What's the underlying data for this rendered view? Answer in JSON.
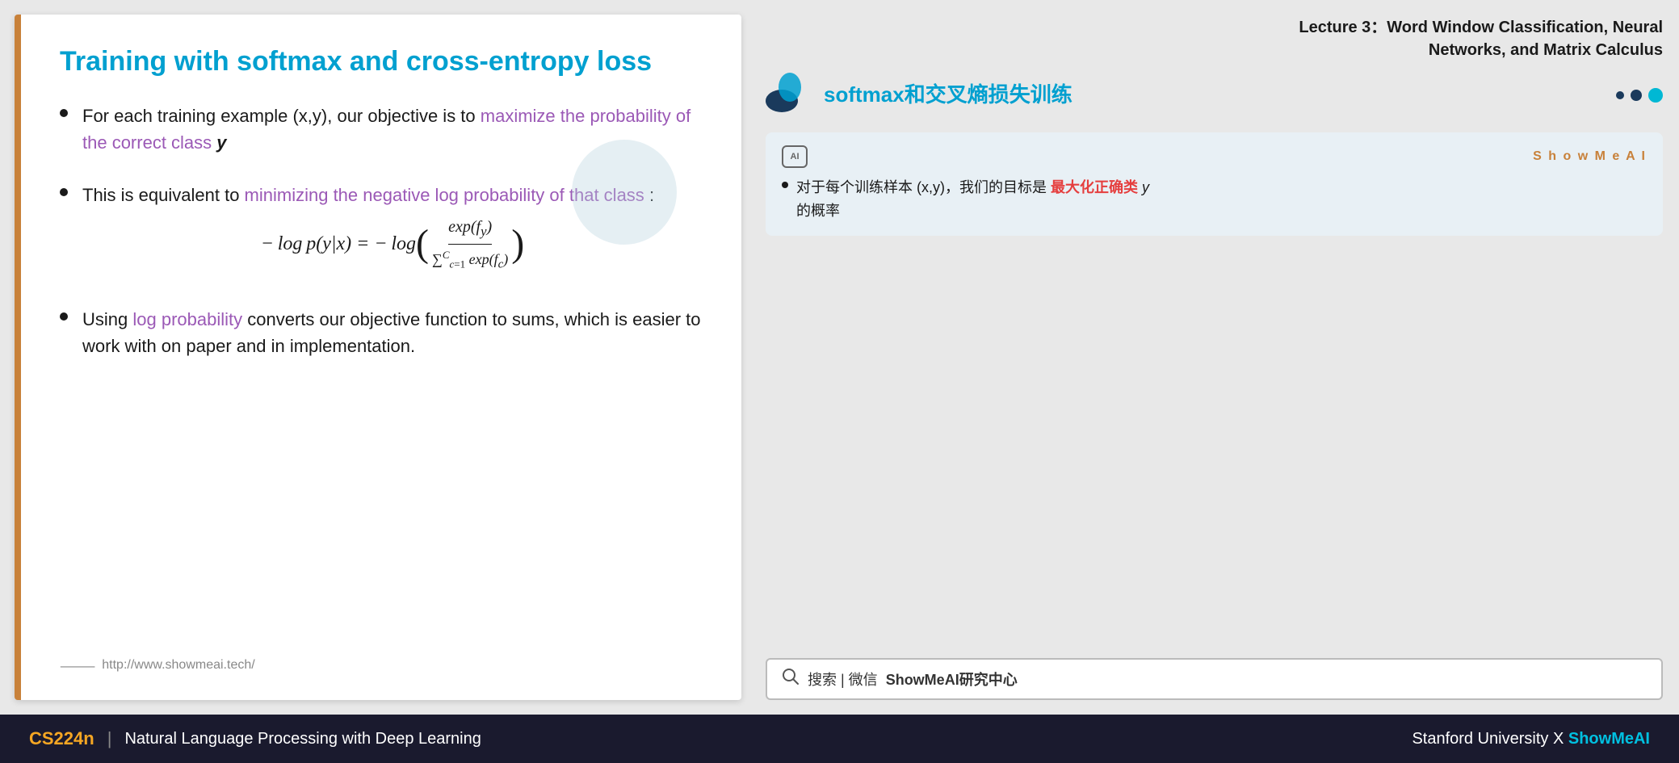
{
  "slide": {
    "title": "Training with softmax and cross-entropy loss",
    "border_color": "#c8813a",
    "bullets": [
      {
        "id": "bullet1",
        "text_before": "For each training example (x,y), our objective is to",
        "highlight_text": "maximize the probability of the correct class",
        "text_after": "y",
        "highlight_color": "#9b59b6"
      },
      {
        "id": "bullet2",
        "text_before": "This is equivalent to",
        "highlight_text": "minimizing the negative log probability of that class",
        "text_colon": ":"
      },
      {
        "id": "bullet3",
        "text_before": "Using",
        "highlight_text": "log probability",
        "text_after": "converts our objective function to sums, which is easier to work with on paper and in implementation."
      }
    ],
    "formula": "−log p(y|x) = −log ( exp(f_y) / Σ(c=1 to C) exp(f_c) )",
    "url": "http://www.showmeai.tech/"
  },
  "right_panel": {
    "lecture_title_line1": "Lecture 3：Word Window Classification, Neural",
    "lecture_title_line2": "Networks, and Matrix Calculus",
    "topic_title": "softmax和交叉熵损失训练",
    "card": {
      "showmeai_label": "S h o w M e A I",
      "ai_badge": "AI",
      "bullet_text_before": "对于每个训练样本 (x,y)，我们的目标是",
      "bullet_highlight": "最大化正确类",
      "bullet_italic": "y",
      "bullet_text_after": "的概率",
      "highlight_color": "#e53e3e"
    },
    "search_bar": {
      "icon": "🔍",
      "text": "搜索 | 微信",
      "brand": "ShowMeAI研究中心"
    }
  },
  "bottom_bar": {
    "course_code": "CS224n",
    "divider": "|",
    "course_name": "Natural Language Processing with Deep Learning",
    "affiliation": "Stanford University",
    "x_symbol": "X",
    "brand": "ShowMeAI"
  }
}
